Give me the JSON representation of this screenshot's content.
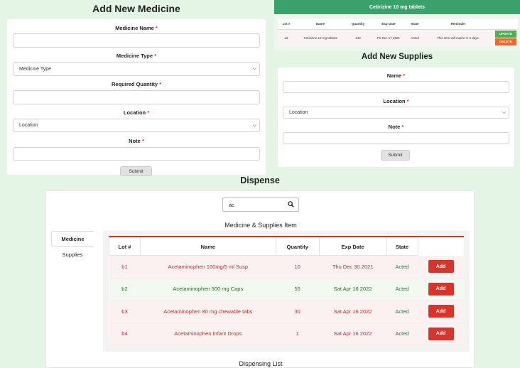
{
  "medicine_form": {
    "title": "Add New Medicine",
    "name_label": "Medicine Name",
    "type_label": "Medicine Type",
    "type_value": "Medicine Type",
    "qty_label": "Required Quantity",
    "location_label": "Location",
    "location_value": "Location",
    "note_label": "Note",
    "submit": "Submit",
    "required_mark": "*"
  },
  "cetirizine": {
    "header": "Cetirizine 10 mg tablets",
    "columns": [
      "Lot #",
      "Name",
      "Quantity",
      "Exp Date",
      "State",
      "Reminder"
    ],
    "row": {
      "lot": "a2",
      "name": "Cetirizine 10 mg tablets",
      "quantity": "143",
      "exp": "Fri Dec 17 2021",
      "state": "Acted",
      "reminder": "This item will expire in 3 days."
    },
    "update": "UPDATE",
    "delete": "DELETE"
  },
  "supplies_form": {
    "title": "Add New Supplies",
    "name_label": "Name",
    "location_label": "Location",
    "location_value": "Location",
    "note_label": "Note",
    "submit": "Submit",
    "required_mark": "*"
  },
  "dispense": {
    "title": "Dispense",
    "search_value": "ac",
    "items_title": "Medicine & Supplies Item",
    "tabs": [
      "Medicine",
      "Supplies"
    ],
    "columns": [
      "Lot #",
      "Name",
      "Quantity",
      "Exp Date",
      "State"
    ],
    "rows": [
      {
        "lot": "b1",
        "name": "Acetaminophen 160mg/5 ml Susp",
        "quantity": "10",
        "exp": "Thu Dec 30 2021",
        "state": "Acted",
        "add": "Add"
      },
      {
        "lot": "b2",
        "name": "Acetaminophen 500 mg Caps",
        "quantity": "55",
        "exp": "Sat Apr 16 2022",
        "state": "Acted",
        "add": "Add"
      },
      {
        "lot": "b3",
        "name": "Acetaminophen 80 mg chewable tabs",
        "quantity": "30",
        "exp": "Sat Apr 16 2022",
        "state": "Acted",
        "add": "Add"
      },
      {
        "lot": "b4",
        "name": "Acetaminophen Infant Drops",
        "quantity": "1",
        "exp": "Sat Apr 16 2022",
        "state": "Acted",
        "add": "Add"
      }
    ],
    "list_title": "Dispensing List"
  },
  "colors": {
    "page_bg": "#e4f5e6",
    "header_green": "#3aa06c",
    "add_red": "#d9342a",
    "update_green": "#4caf50",
    "delete_orange": "#f0662e"
  },
  "icons": {
    "search": "search-icon",
    "select_caret": "chevron-down-icon"
  }
}
